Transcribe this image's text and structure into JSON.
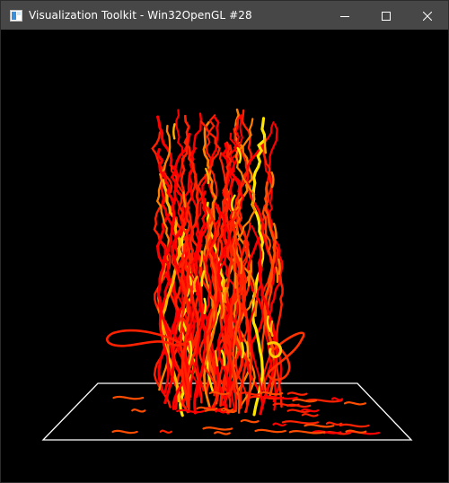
{
  "window": {
    "title": "Visualization Toolkit - Win32OpenGL #28",
    "icon": "vtk-app-icon",
    "controls": [
      {
        "name": "minimize-button",
        "icon": "minimize-icon"
      },
      {
        "name": "maximize-button",
        "icon": "maximize-icon"
      },
      {
        "name": "close-button",
        "icon": "close-icon"
      }
    ]
  },
  "scene": {
    "background": "#000000",
    "outline_color": "#ffffff",
    "streamline_colors": [
      "#ff0000",
      "#ff2200",
      "#ff4d00",
      "#ff8000",
      "#ffb300",
      "#ffe600"
    ]
  }
}
